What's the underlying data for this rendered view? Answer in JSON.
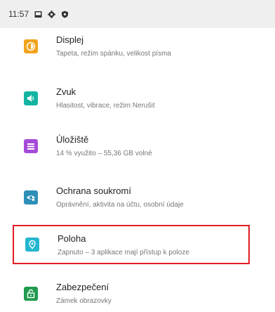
{
  "status_bar": {
    "time": "11:57",
    "icons": [
      "image-icon",
      "gear-icon",
      "shield-icon"
    ]
  },
  "settings": [
    {
      "title": "Displej",
      "subtitle": "Tapeta, režim spánku, velikost písma",
      "icon": "brightness-icon",
      "color": "#f2a31b"
    },
    {
      "title": "Zvuk",
      "subtitle": "Hlasitost, vibrace, režim Nerušit",
      "icon": "volume-icon",
      "color": "#14b3a2"
    },
    {
      "title": "Úložiště",
      "subtitle": "14 % využito – 55,36 GB volné",
      "icon": "storage-icon",
      "color": "#a64bd9"
    },
    {
      "title": "Ochrana soukromí",
      "subtitle": "Oprávnění, aktivita na účtu, osobní údaje",
      "icon": "privacy-icon",
      "color": "#2e8fb8"
    },
    {
      "title": "Poloha",
      "subtitle": "Zapnuto – 3 aplikace mají přístup k poloze",
      "icon": "location-icon",
      "color": "#25b6cf",
      "highlighted": true
    },
    {
      "title": "Zabezpečení",
      "subtitle": "Zámek obrazovky",
      "icon": "lock-icon",
      "color": "#1f9a4f"
    }
  ]
}
